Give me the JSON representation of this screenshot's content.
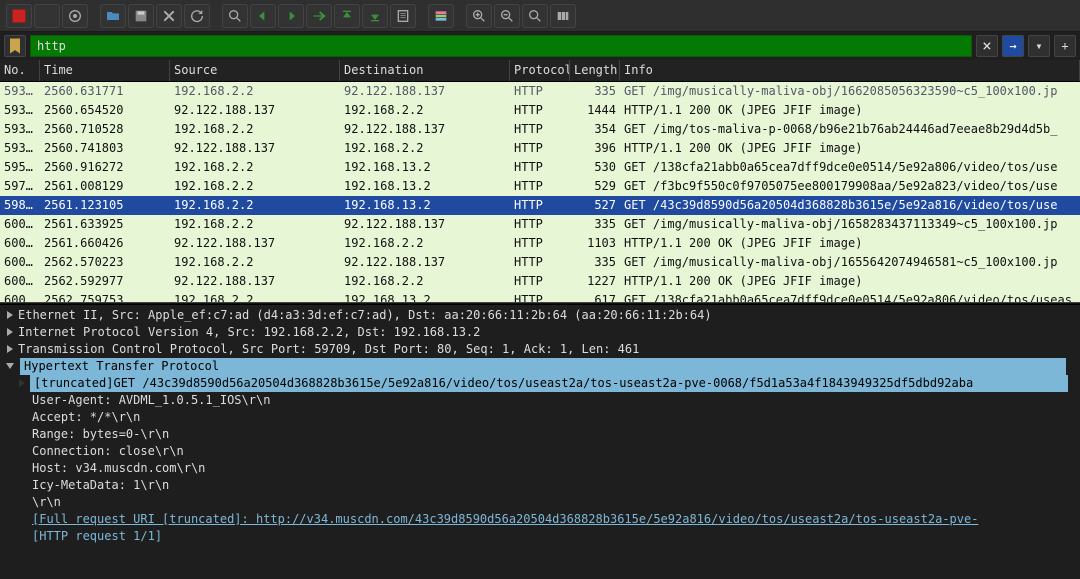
{
  "filter": {
    "value": "http",
    "clear_icon": "×",
    "arrow_icon": "→",
    "plus_icon": "+"
  },
  "columns": {
    "no": "No.",
    "time": "Time",
    "source": "Source",
    "destination": "Destination",
    "protocol": "Protocol",
    "length": "Length",
    "info": "Info"
  },
  "packets": [
    {
      "no": "593…",
      "time": "2560.631771",
      "src": "192.168.2.2",
      "dst": "92.122.188.137",
      "proto": "HTTP",
      "len": "335",
      "info": "GET /img/musically-maliva-obj/1662085056323590~c5_100x100.jp",
      "dim": true
    },
    {
      "no": "593…",
      "time": "2560.654520",
      "src": "92.122.188.137",
      "dst": "192.168.2.2",
      "proto": "HTTP",
      "len": "1444",
      "info": "HTTP/1.1 200 OK  (JPEG JFIF image)"
    },
    {
      "no": "593…",
      "time": "2560.710528",
      "src": "192.168.2.2",
      "dst": "92.122.188.137",
      "proto": "HTTP",
      "len": "354",
      "info": "GET /img/tos-maliva-p-0068/b96e21b76ab24446ad7eeae8b29d4d5b_"
    },
    {
      "no": "593…",
      "time": "2560.741803",
      "src": "92.122.188.137",
      "dst": "192.168.2.2",
      "proto": "HTTP",
      "len": "396",
      "info": "HTTP/1.1 200 OK  (JPEG JFIF image)"
    },
    {
      "no": "595…",
      "time": "2560.916272",
      "src": "192.168.2.2",
      "dst": "192.168.13.2",
      "proto": "HTTP",
      "len": "530",
      "info": "GET /138cfa21abb0a65cea7dff9dce0e0514/5e92a806/video/tos/use"
    },
    {
      "no": "597…",
      "time": "2561.008129",
      "src": "192.168.2.2",
      "dst": "192.168.13.2",
      "proto": "HTTP",
      "len": "529",
      "info": "GET /f3bc9f550c0f9705075ee800179908aa/5e92a823/video/tos/use"
    },
    {
      "no": "598…",
      "time": "2561.123105",
      "src": "192.168.2.2",
      "dst": "192.168.13.2",
      "proto": "HTTP",
      "len": "527",
      "info": "GET /43c39d8590d56a20504d368828b3615e/5e92a816/video/tos/use",
      "selected": true
    },
    {
      "no": "600…",
      "time": "2561.633925",
      "src": "192.168.2.2",
      "dst": "92.122.188.137",
      "proto": "HTTP",
      "len": "335",
      "info": "GET /img/musically-maliva-obj/1658283437113349~c5_100x100.jp"
    },
    {
      "no": "600…",
      "time": "2561.660426",
      "src": "92.122.188.137",
      "dst": "192.168.2.2",
      "proto": "HTTP",
      "len": "1103",
      "info": "HTTP/1.1 200 OK  (JPEG JFIF image)"
    },
    {
      "no": "600…",
      "time": "2562.570223",
      "src": "192.168.2.2",
      "dst": "92.122.188.137",
      "proto": "HTTP",
      "len": "335",
      "info": "GET /img/musically-maliva-obj/1655642074946581~c5_100x100.jp"
    },
    {
      "no": "600…",
      "time": "2562.592977",
      "src": "92.122.188.137",
      "dst": "192.168.2.2",
      "proto": "HTTP",
      "len": "1227",
      "info": "HTTP/1.1 200 OK  (JPEG JFIF image)"
    },
    {
      "no": "600…",
      "time": "2562.759753",
      "src": "192.168.2.2",
      "dst": "192.168.13.2",
      "proto": "HTTP",
      "len": "617",
      "info": "GET /138cfa21abb0a65cea7dff9dce0e0514/5e92a806/video/tos/useas"
    }
  ],
  "tree": {
    "ethernet": "Ethernet II, Src: Apple_ef:c7:ad (d4:a3:3d:ef:c7:ad), Dst: aa:20:66:11:2b:64 (aa:20:66:11:2b:64)",
    "ip": "Internet Protocol Version 4, Src: 192.168.2.2, Dst: 192.168.13.2",
    "tcp": "Transmission Control Protocol, Src Port: 59709, Dst Port: 80, Seq: 1, Ack: 1, Len: 461",
    "http": "Hypertext Transfer Protocol",
    "get_line": "[truncated]GET /43c39d8590d56a20504d368828b3615e/5e92a816/video/tos/useast2a/tos-useast2a-pve-0068/f5d1a53a4f1843949325df5dbd92aba",
    "lines": [
      "User-Agent: AVDML_1.0.5.1_IOS\\r\\n",
      "Accept: */*\\r\\n",
      "Range: bytes=0-\\r\\n",
      "Connection: close\\r\\n",
      "Host: v34.muscdn.com\\r\\n",
      "Icy-MetaData: 1\\r\\n",
      "\\r\\n"
    ],
    "full_uri": "[Full request URI [truncated]: http://v34.muscdn.com/43c39d8590d56a20504d368828b3615e/5e92a816/video/tos/useast2a/tos-useast2a-pve-",
    "req_footer": "[HTTP request 1/1]"
  }
}
